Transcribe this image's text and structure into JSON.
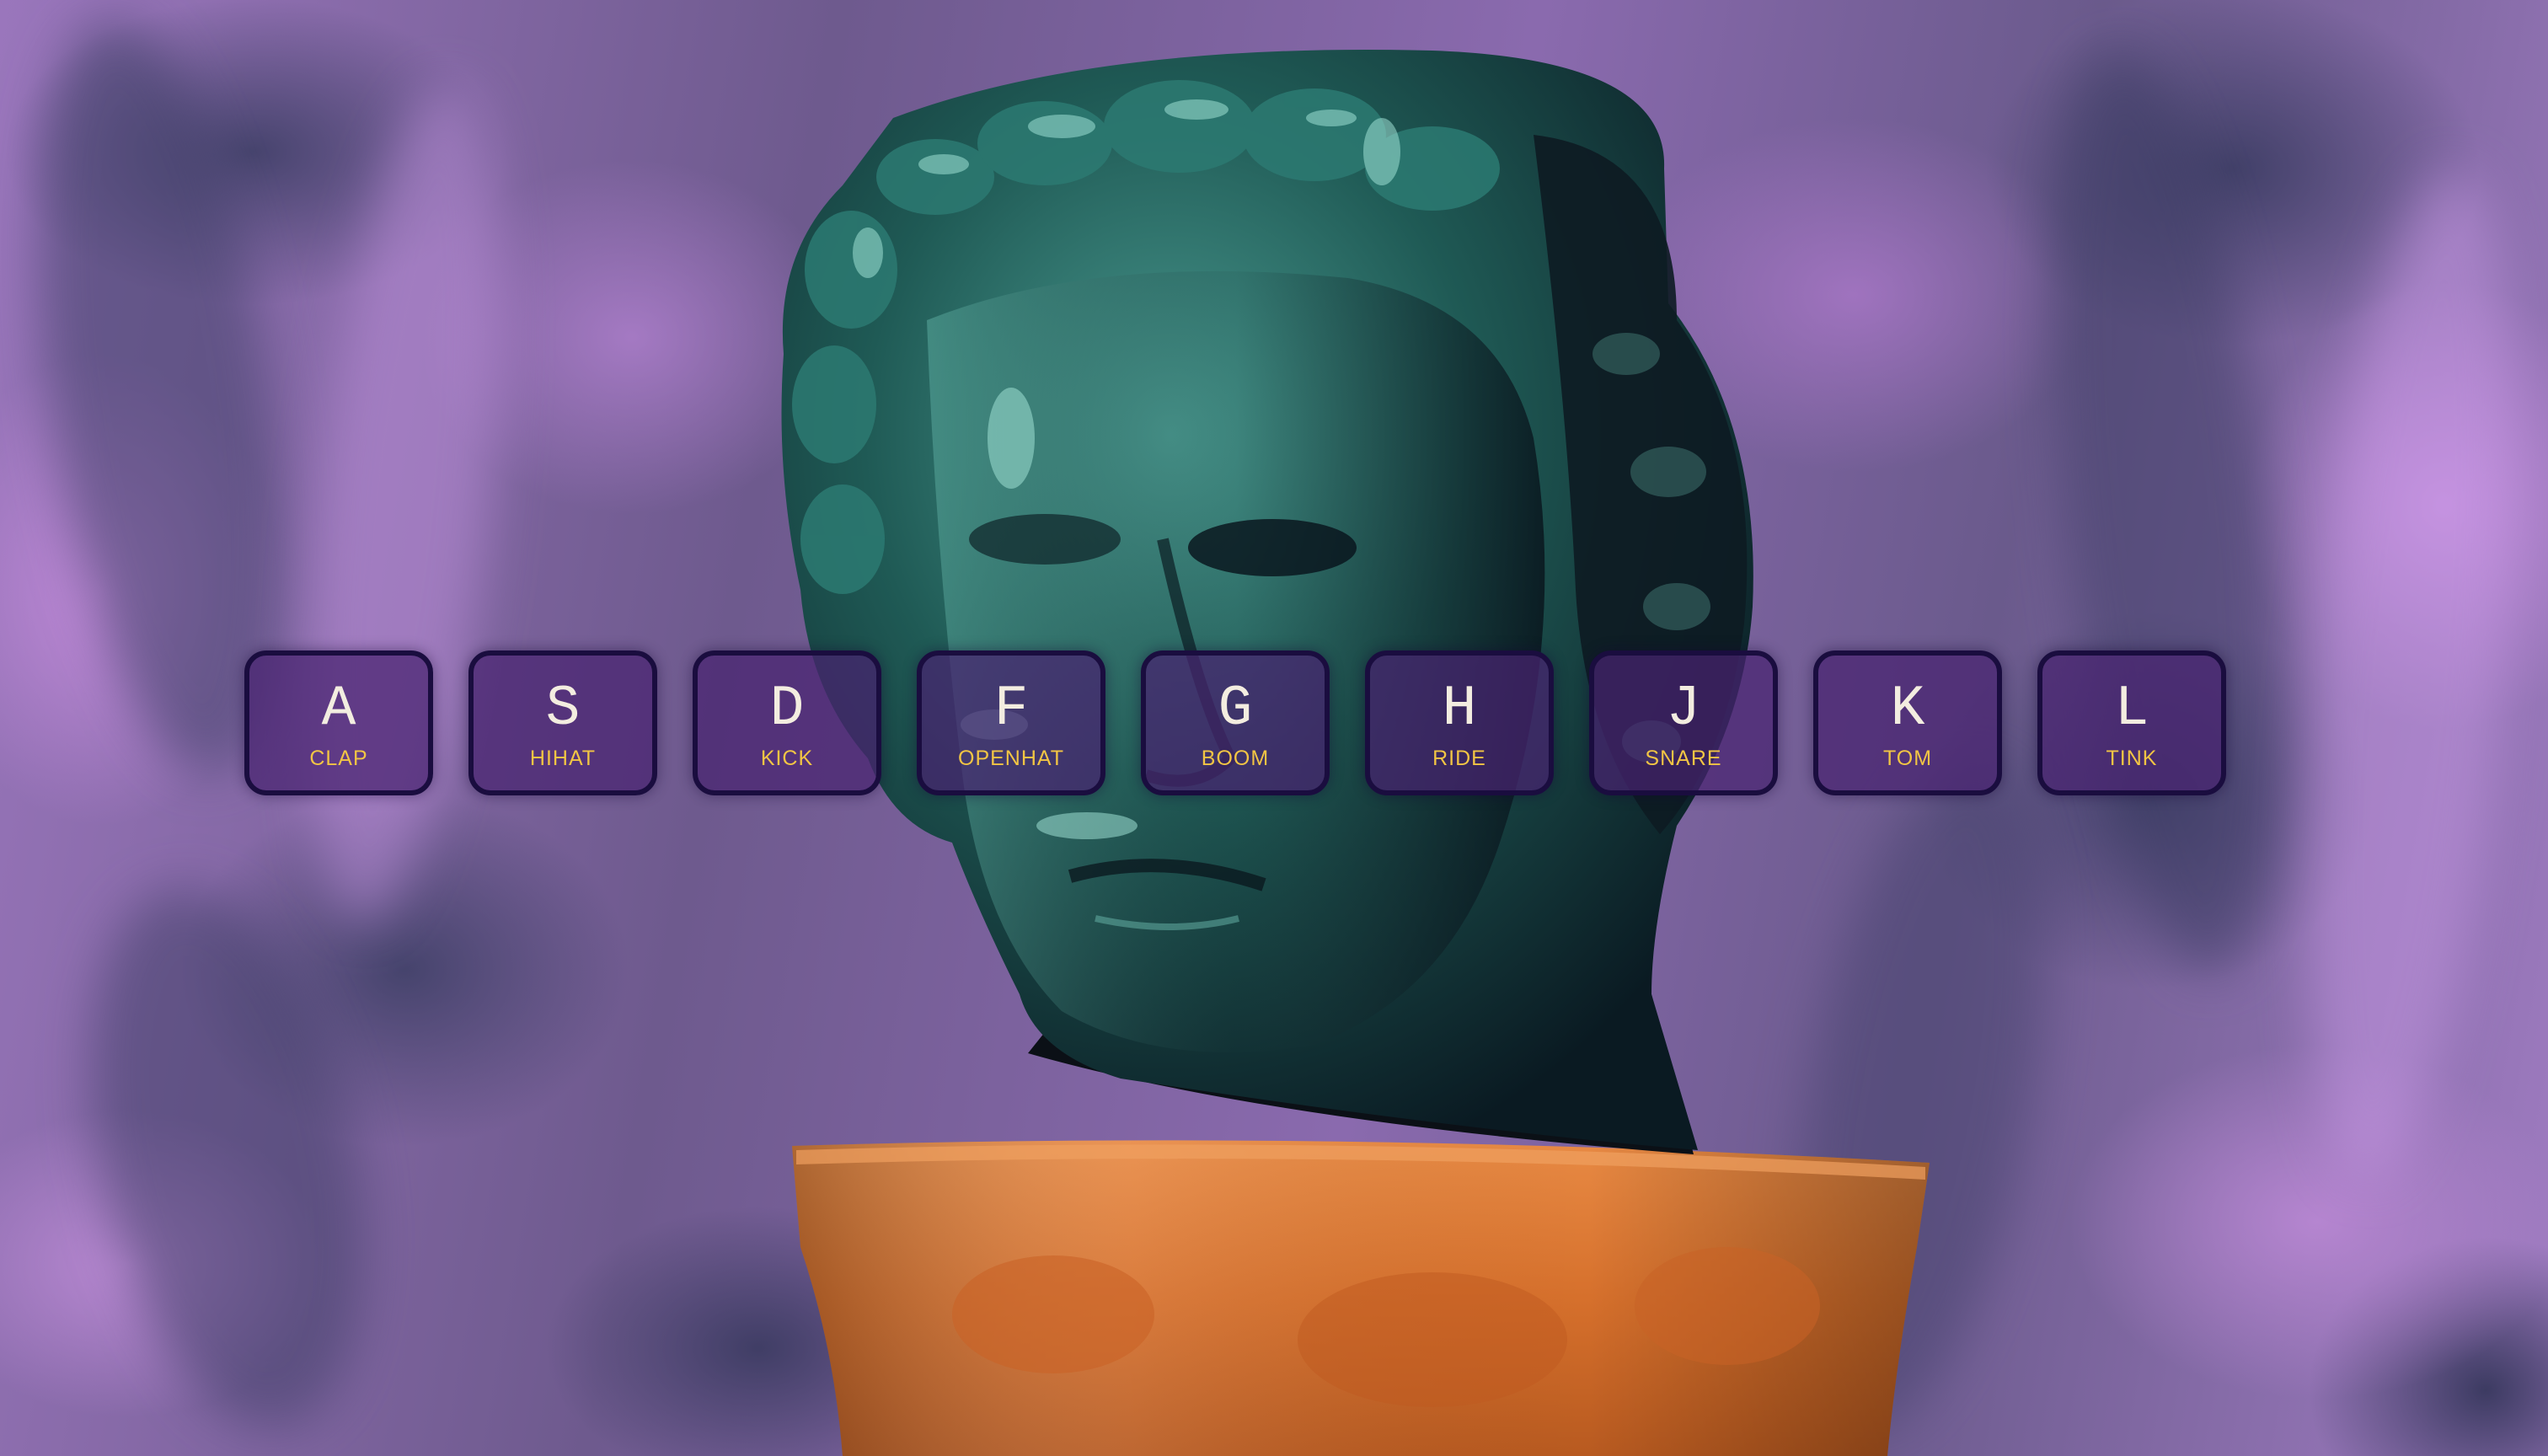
{
  "colors": {
    "key_border": "#1a0d3f",
    "key_fill": "#482270",
    "letter": "#f3ede0",
    "sound_label": "#f2c544",
    "statue_head": "#1f5a55",
    "pedestal": "#d6702c",
    "background": "#8a6aa8"
  },
  "drum_keys": [
    {
      "letter": "A",
      "sound": "CLAP"
    },
    {
      "letter": "S",
      "sound": "HIHAT"
    },
    {
      "letter": "D",
      "sound": "KICK"
    },
    {
      "letter": "F",
      "sound": "OPENHAT"
    },
    {
      "letter": "G",
      "sound": "BOOM"
    },
    {
      "letter": "H",
      "sound": "RIDE"
    },
    {
      "letter": "J",
      "sound": "SNARE"
    },
    {
      "letter": "K",
      "sound": "TOM"
    },
    {
      "letter": "L",
      "sound": "TINK"
    }
  ]
}
